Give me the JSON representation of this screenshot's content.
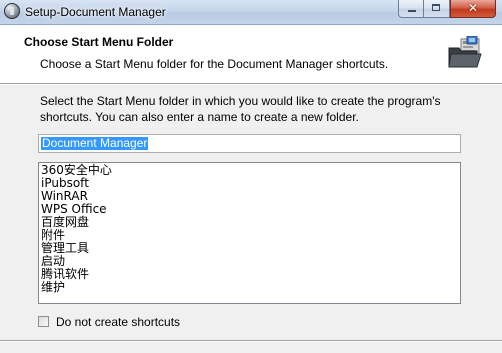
{
  "window": {
    "title": "Setup-Document Manager",
    "close_glyph": "✕"
  },
  "header": {
    "title": "Choose Start Menu Folder",
    "subtitle": "Choose a Start Menu folder for the Document Manager shortcuts.",
    "icon": "start-menu-folder-icon"
  },
  "body": {
    "instructions": "Select the Start Menu folder in which you would like to create the program's shortcuts. You can also enter a name to create a new folder.",
    "folder_name_value": "Document Manager",
    "folder_list": [
      "360安全中心",
      "iPubsoft",
      "WinRAR",
      "WPS Office",
      "百度网盘",
      "附件",
      "管理工具",
      "启动",
      "腾讯软件",
      "维护"
    ],
    "no_shortcuts_label": "Do not create shortcuts",
    "no_shortcuts_checked": false
  },
  "colors": {
    "selection": "#3399ff",
    "close_button": "#c0391f",
    "titlebar": "#c4d5ea"
  }
}
